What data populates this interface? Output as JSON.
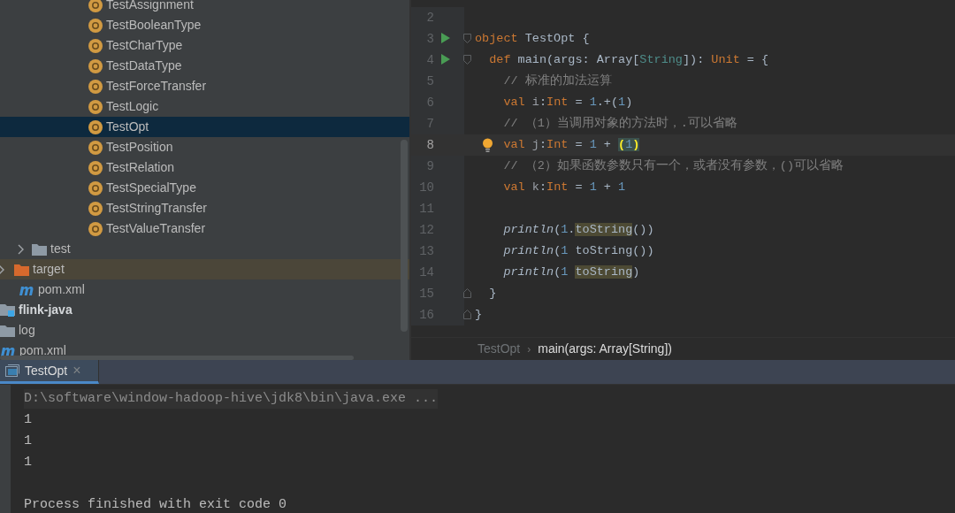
{
  "project_tree": {
    "class_items": [
      {
        "label": "TestAssignment",
        "kind": "class",
        "selected": false
      },
      {
        "label": "TestBooleanType",
        "kind": "class",
        "selected": false
      },
      {
        "label": "TestCharType",
        "kind": "class",
        "selected": false
      },
      {
        "label": "TestDataType",
        "kind": "class",
        "selected": false
      },
      {
        "label": "TestForceTransfer",
        "kind": "class",
        "selected": false
      },
      {
        "label": "TestLogic",
        "kind": "class",
        "selected": false
      },
      {
        "label": "TestOpt",
        "kind": "class",
        "selected": true
      },
      {
        "label": "TestPosition",
        "kind": "class",
        "selected": false
      },
      {
        "label": "TestRelation",
        "kind": "class",
        "selected": false
      },
      {
        "label": "TestSpecialType",
        "kind": "class",
        "selected": false
      },
      {
        "label": "TestStringTransfer",
        "kind": "class",
        "selected": false
      },
      {
        "label": "TestValueTransfer",
        "kind": "class",
        "selected": false
      }
    ],
    "src_items": [
      {
        "label": "test",
        "kind": "folder",
        "expanded": false,
        "selected": false
      }
    ],
    "module_items": [
      {
        "label": "target",
        "kind": "excluded-folder",
        "expanded": false,
        "selected": false
      },
      {
        "label": "pom.xml",
        "kind": "maven",
        "selected": false
      }
    ],
    "project_items": [
      {
        "label": "flink-java",
        "kind": "module",
        "selected": false
      },
      {
        "label": "log",
        "kind": "folder",
        "selected": false
      },
      {
        "label": "pom.xml",
        "kind": "maven",
        "selected": false
      }
    ]
  },
  "editor": {
    "lines": [
      {
        "number": "2"
      },
      {
        "number": "3",
        "run": true,
        "fold_start": true,
        "tokens": [
          {
            "kind": "keyword",
            "text": "object"
          },
          {
            "kind": "plain",
            "text": " TestOpt {"
          }
        ]
      },
      {
        "number": "4",
        "run": true,
        "fold_start": true,
        "tokens": [
          {
            "kind": "keyword",
            "text": "  def"
          },
          {
            "kind": "plain",
            "text": " main(args: Array["
          },
          {
            "kind": "type-param",
            "text": "String"
          },
          {
            "kind": "plain",
            "text": "]): "
          },
          {
            "kind": "keyword",
            "text": "Unit"
          },
          {
            "kind": "plain",
            "text": " = {"
          }
        ]
      },
      {
        "number": "5",
        "tokens": [
          {
            "kind": "comment",
            "text": "    // 标准的加法运算"
          }
        ]
      },
      {
        "number": "6",
        "tokens": [
          {
            "kind": "keyword",
            "text": "    val"
          },
          {
            "kind": "var",
            "text": " i"
          },
          {
            "kind": "plain",
            "text": ":"
          },
          {
            "kind": "keyword",
            "text": "Int"
          },
          {
            "kind": "plain",
            "text": " = "
          },
          {
            "kind": "number",
            "text": "1"
          },
          {
            "kind": "plain",
            "text": ".+("
          },
          {
            "kind": "number",
            "text": "1"
          },
          {
            "kind": "plain",
            "text": ")"
          }
        ]
      },
      {
        "number": "7",
        "tokens": [
          {
            "kind": "comment",
            "text": "    // （1）当调用对象的方法时，.可以省略"
          }
        ]
      },
      {
        "number": "8",
        "current": true,
        "bulb": true,
        "tokens": [
          {
            "kind": "keyword",
            "text": "    val"
          },
          {
            "kind": "var",
            "text": " j"
          },
          {
            "kind": "plain",
            "text": ":"
          },
          {
            "kind": "keyword",
            "text": "Int"
          },
          {
            "kind": "plain",
            "text": " = "
          },
          {
            "kind": "number",
            "text": "1"
          },
          {
            "kind": "plain",
            "text": " + "
          },
          {
            "kind": "bracket",
            "text": "("
          },
          {
            "kind": "matched-number",
            "text": "1"
          },
          {
            "kind": "bracket",
            "text": ")"
          }
        ]
      },
      {
        "number": "9",
        "tokens": [
          {
            "kind": "comment",
            "text": "    // （2）如果函数参数只有一个，或者没有参数，()可以省略"
          }
        ]
      },
      {
        "number": "10",
        "tokens": [
          {
            "kind": "keyword",
            "text": "    val"
          },
          {
            "kind": "var",
            "text": " k"
          },
          {
            "kind": "plain",
            "text": ":"
          },
          {
            "kind": "keyword",
            "text": "Int"
          },
          {
            "kind": "plain",
            "text": " = "
          },
          {
            "kind": "number",
            "text": "1"
          },
          {
            "kind": "plain",
            "text": " + "
          },
          {
            "kind": "number",
            "text": "1"
          }
        ]
      },
      {
        "number": "11"
      },
      {
        "number": "12",
        "tokens": [
          {
            "kind": "method",
            "text": "    println"
          },
          {
            "kind": "plain",
            "text": "("
          },
          {
            "kind": "number",
            "text": "1"
          },
          {
            "kind": "plain",
            "text": "."
          },
          {
            "kind": "usage",
            "text": "toString"
          },
          {
            "kind": "plain",
            "text": "())"
          }
        ]
      },
      {
        "number": "13",
        "tokens": [
          {
            "kind": "method",
            "text": "    println"
          },
          {
            "kind": "plain",
            "text": "("
          },
          {
            "kind": "number",
            "text": "1"
          },
          {
            "kind": "plain",
            "text": " toString())"
          }
        ]
      },
      {
        "number": "14",
        "tokens": [
          {
            "kind": "method",
            "text": "    println"
          },
          {
            "kind": "plain",
            "text": "("
          },
          {
            "kind": "number",
            "text": "1 "
          },
          {
            "kind": "usage",
            "text": "toString"
          },
          {
            "kind": "plain",
            "text": ")"
          }
        ]
      },
      {
        "number": "15",
        "fold_end": true,
        "tokens": [
          {
            "kind": "plain",
            "text": "  }"
          }
        ]
      },
      {
        "number": "16",
        "fold_end": true,
        "tokens": [
          {
            "kind": "plain",
            "text": "}"
          }
        ]
      }
    ],
    "breadcrumbs": [
      {
        "label": "TestOpt",
        "selected": false
      },
      {
        "label": "main(args: Array[String])",
        "selected": true
      }
    ],
    "breadcrumb_separator": "›"
  },
  "run_panel": {
    "tabs": [
      {
        "label": "TestOpt",
        "selected": true,
        "close": "×"
      }
    ],
    "console": [
      {
        "kind": "command",
        "text": "D:\\software\\window-hadoop-hive\\jdk8\\bin\\java.exe ..."
      },
      {
        "kind": "output",
        "text": "1"
      },
      {
        "kind": "output",
        "text": "1"
      },
      {
        "kind": "output",
        "text": "1"
      },
      {
        "kind": "blank"
      },
      {
        "kind": "output",
        "text": "Process finished with exit code 0"
      }
    ]
  }
}
